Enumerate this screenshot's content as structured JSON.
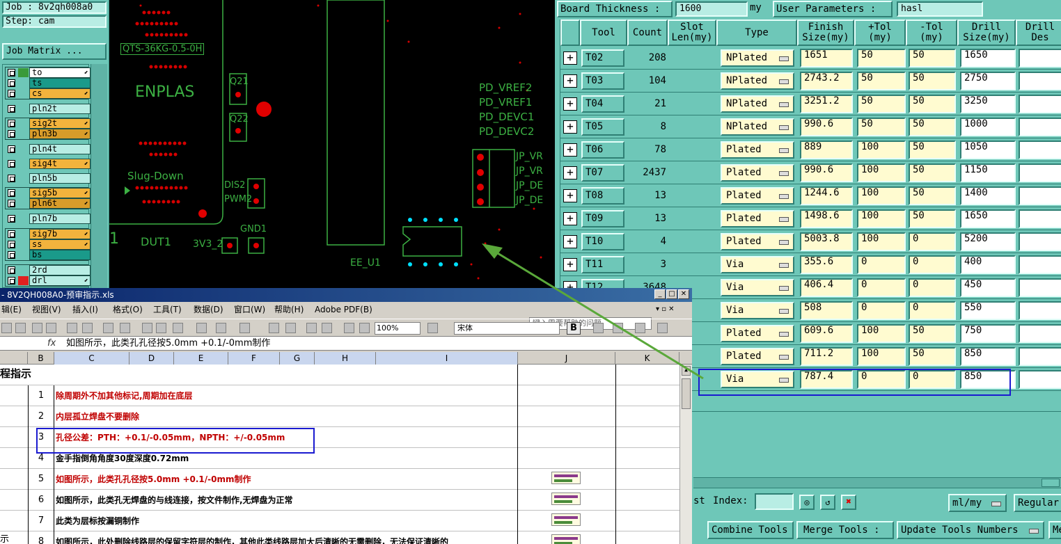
{
  "left_panel": {
    "job_label": "Job : 8v2qh008a0",
    "step_label": "Step: cam",
    "job_matrix_button": "Job Matrix ...",
    "layers": [
      {
        "name": "to",
        "color": "#ffffff",
        "swatch": "#3a9a3a",
        "arrow": true
      },
      {
        "name": "ts",
        "color": "#1a9a8a",
        "swatch": "#6ec7b8",
        "arrow": false
      },
      {
        "name": "cs",
        "color": "#f2b33d",
        "swatch": "#6ec7b8",
        "arrow": true
      },
      {
        "name": "pln2t",
        "color": "#b8ede4",
        "swatch": "#6ec7b8",
        "arrow": false
      },
      {
        "name": "sig2t",
        "color": "#f2b33d",
        "swatch": "#6ec7b8",
        "arrow": true
      },
      {
        "name": "pln3b",
        "color": "#d89c2a",
        "swatch": "#6ec7b8",
        "arrow": true
      },
      {
        "name": "pln4t",
        "color": "#b8ede4",
        "swatch": "#6ec7b8",
        "arrow": false
      },
      {
        "name": "sig4t",
        "color": "#f2b33d",
        "swatch": "#6ec7b8",
        "arrow": true
      },
      {
        "name": "pln5b",
        "color": "#b8ede4",
        "swatch": "#6ec7b8",
        "arrow": false
      },
      {
        "name": "sig5b",
        "color": "#f2b33d",
        "swatch": "#6ec7b8",
        "arrow": true
      },
      {
        "name": "pln6t",
        "color": "#d89c2a",
        "swatch": "#6ec7b8",
        "arrow": true
      },
      {
        "name": "pln7b",
        "color": "#b8ede4",
        "swatch": "#6ec7b8",
        "arrow": false
      },
      {
        "name": "sig7b",
        "color": "#f2b33d",
        "swatch": "#6ec7b8",
        "arrow": true
      },
      {
        "name": "ss",
        "color": "#f2b33d",
        "swatch": "#6ec7b8",
        "arrow": true
      },
      {
        "name": "bs",
        "color": "#1a9a8a",
        "swatch": "#6ec7b8",
        "arrow": false
      },
      {
        "name": "2rd",
        "color": "#b8ede4",
        "swatch": "#6ec7b8",
        "arrow": false
      },
      {
        "name": "drl",
        "color": "#b8ede4",
        "swatch": "#e02020",
        "arrow": true
      }
    ]
  },
  "pcb": {
    "labels": {
      "part": "QTS-36KG-0.5-0H",
      "brand": "ENPLAS",
      "slug": "Slug-Down",
      "dut": "DUT1",
      "one": "1",
      "v33": "3V3_2",
      "gnd": "GND1",
      "q21": "Q21",
      "q22": "Q22",
      "dis2": "DIS2",
      "pwm2": "PWM2",
      "ee": "EE_U1",
      "pd_vref2": "PD_VREF2",
      "pd_vref1": "PD_VREF1",
      "pd_devc1": "PD_DEVC1",
      "pd_devc2": "PD_DEVC2",
      "jp1": "JP_VR",
      "jp2": "JP_VR",
      "jp3": "JP_DE",
      "jp4": "JP_DE"
    }
  },
  "excel": {
    "title": "- 8V2QH008A0-预审指示.xls",
    "menu": [
      "辑(E)",
      "视图(V)",
      "插入(I)",
      "格式(O)",
      "工具(T)",
      "数据(D)",
      "窗口(W)",
      "帮助(H)",
      "Adobe PDF(B)"
    ],
    "help_placeholder": "键入需要帮助的问题",
    "zoom": "100%",
    "font": "宋体",
    "bold": "B",
    "fx": "fx",
    "formula": "如图所示，此类孔孔径按5.0mm +0.1/-0mm制作",
    "columns": [
      "B",
      "C",
      "D",
      "E",
      "F",
      "G",
      "H",
      "I",
      "J",
      "K"
    ],
    "header_cell": "程指示",
    "side_label": "示",
    "rows": [
      {
        "num": "1",
        "text": "除周期外不加其他标记,周期加在底层",
        "red": true,
        "thumb": false
      },
      {
        "num": "2",
        "text": "内层孤立焊盘不要删除",
        "red": true,
        "thumb": false
      },
      {
        "num": "3",
        "text": "孔径公差：PTH：+0.1/-0.05mm，NPTH：+/-0.05mm",
        "red": true,
        "thumb": false
      },
      {
        "num": "4",
        "text": "金手指倒角角度30度深度0.72mm",
        "red": false,
        "thumb": false
      },
      {
        "num": "5",
        "text": "如图所示，此类孔孔径按5.0mm +0.1/-0mm制作",
        "red": true,
        "thumb": true
      },
      {
        "num": "6",
        "text": "如图所示，此类孔无焊盘的与线连接，按文件制作,无焊盘为正常",
        "red": false,
        "thumb": true
      },
      {
        "num": "7",
        "text": "此类为层标按漏铜制作",
        "red": false,
        "thumb": true
      },
      {
        "num": "8",
        "text": "如图所示，此处删除线路层的保留字符层的制作，其他此类线路层加大后清晰的无需删除，无法保证清晰的",
        "red": false,
        "thumb": true
      }
    ]
  },
  "right_panel": {
    "board_thickness_label": "Board Thickness :",
    "board_thickness_value": "1600",
    "unit": "my",
    "user_params_label": "User Parameters :",
    "user_params_value": "hasl",
    "headers": [
      "Tool",
      "Count",
      "Slot\nLen(my)",
      "Type",
      "Finish\nSize(my)",
      "+Tol\n(my)",
      "-Tol\n(my)",
      "Drill\nSize(my)",
      "Drill\nDes"
    ],
    "rows": [
      {
        "tool": "T02",
        "count": "208",
        "type": "NPlated",
        "finish": "1651",
        "ptol": "50",
        "ntol": "50",
        "drill": "1650"
      },
      {
        "tool": "T03",
        "count": "104",
        "type": "NPlated",
        "finish": "2743.2",
        "ptol": "50",
        "ntol": "50",
        "drill": "2750"
      },
      {
        "tool": "T04",
        "count": "21",
        "type": "NPlated",
        "finish": "3251.2",
        "ptol": "50",
        "ntol": "50",
        "drill": "3250"
      },
      {
        "tool": "T05",
        "count": "8",
        "type": "NPlated",
        "finish": "990.6",
        "ptol": "50",
        "ntol": "50",
        "drill": "1000"
      },
      {
        "tool": "T06",
        "count": "78",
        "type": "Plated",
        "finish": "889",
        "ptol": "100",
        "ntol": "50",
        "drill": "1050"
      },
      {
        "tool": "T07",
        "count": "2437",
        "type": "Plated",
        "finish": "990.6",
        "ptol": "100",
        "ntol": "50",
        "drill": "1150"
      },
      {
        "tool": "T08",
        "count": "13",
        "type": "Plated",
        "finish": "1244.6",
        "ptol": "100",
        "ntol": "50",
        "drill": "1400"
      },
      {
        "tool": "T09",
        "count": "13",
        "type": "Plated",
        "finish": "1498.6",
        "ptol": "100",
        "ntol": "50",
        "drill": "1650"
      },
      {
        "tool": "T10",
        "count": "4",
        "type": "Plated",
        "finish": "5003.8",
        "ptol": "100",
        "ntol": "0",
        "drill": "5200"
      },
      {
        "tool": "T11",
        "count": "3",
        "type": "Via",
        "finish": "355.6",
        "ptol": "0",
        "ntol": "0",
        "drill": "400"
      },
      {
        "tool": "T12",
        "count": "3648",
        "type": "Via",
        "finish": "406.4",
        "ptol": "0",
        "ntol": "0",
        "drill": "450"
      },
      {
        "tool": "",
        "count": "",
        "type": "Via",
        "finish": "508",
        "ptol": "0",
        "ntol": "0",
        "drill": "550"
      },
      {
        "tool": "",
        "count": "",
        "type": "Plated",
        "finish": "609.6",
        "ptol": "100",
        "ntol": "50",
        "drill": "750"
      },
      {
        "tool": "",
        "count": "",
        "type": "Plated",
        "finish": "711.2",
        "ptol": "100",
        "ntol": "50",
        "drill": "850"
      },
      {
        "tool": "",
        "count": "",
        "type": "Via",
        "finish": "787.4",
        "ptol": "0",
        "ntol": "0",
        "drill": "850"
      }
    ],
    "bottom": {
      "list_label": "st",
      "index_label": "Index:",
      "units": "ml/my",
      "mode": "Regular",
      "combine": "Combine Tools",
      "merge": "Merge Tools :",
      "update": "Update Tools Numbers",
      "more": "Me"
    }
  },
  "colors": {
    "panel": "#6ec7b8",
    "highlight": "#1a1ad0",
    "arrow": "#5aa83a",
    "pcb_red": "#e00000",
    "pcb_green": "#3cb043"
  }
}
